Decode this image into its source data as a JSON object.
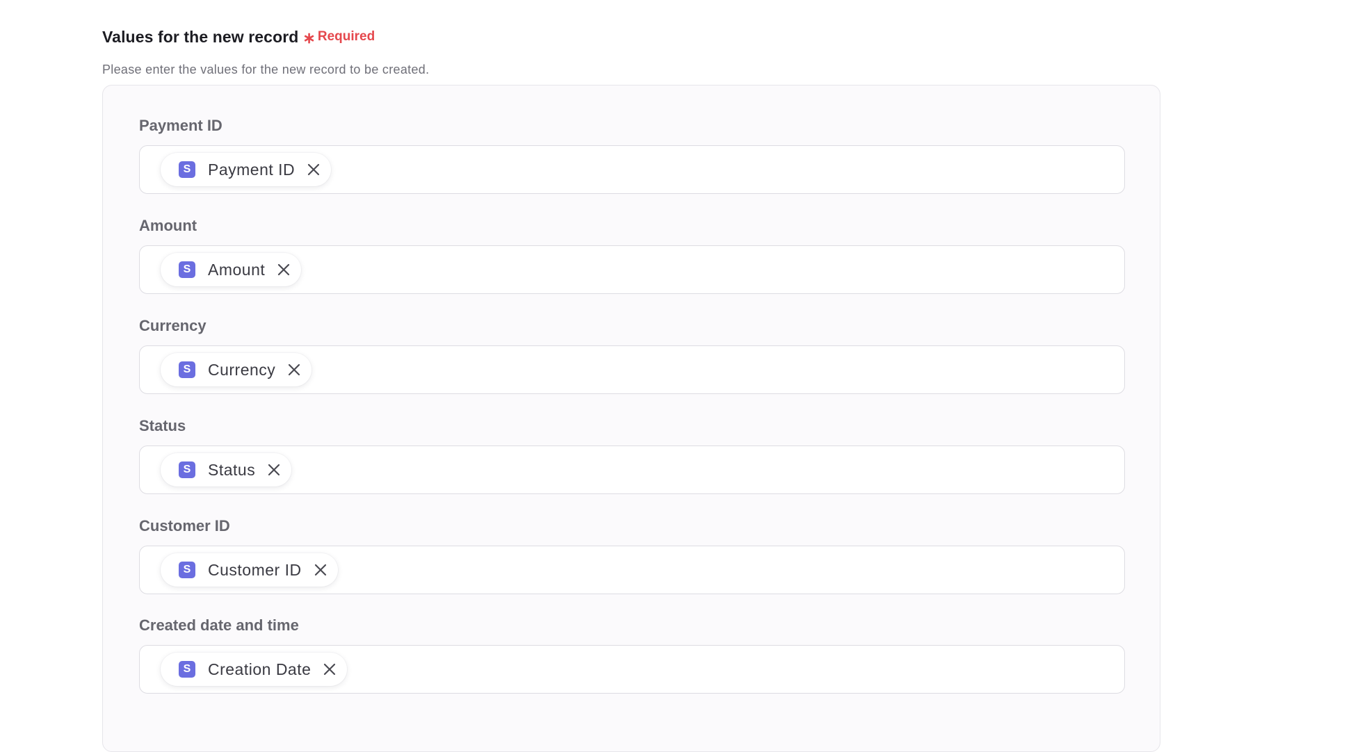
{
  "section": {
    "title": "Values for the new record",
    "required_label": "Required",
    "required_star": "∗",
    "description": "Please enter the values for the new record to be created."
  },
  "fields": [
    {
      "label": "Payment ID",
      "chip": {
        "icon": "S",
        "label": "Payment ID"
      }
    },
    {
      "label": "Amount",
      "chip": {
        "icon": "S",
        "label": "Amount"
      }
    },
    {
      "label": "Currency",
      "chip": {
        "icon": "S",
        "label": "Currency"
      }
    },
    {
      "label": "Status",
      "chip": {
        "icon": "S",
        "label": "Status"
      }
    },
    {
      "label": "Customer ID",
      "chip": {
        "icon": "S",
        "label": "Customer ID"
      }
    },
    {
      "label": "Created date and time",
      "chip": {
        "icon": "S",
        "label": "Creation Date"
      }
    }
  ],
  "colors": {
    "required": "#e5484d",
    "chip_icon": "#6b6ee0"
  },
  "icons": {
    "chip_icon": "stripe-s-icon",
    "remove": "close-icon"
  }
}
